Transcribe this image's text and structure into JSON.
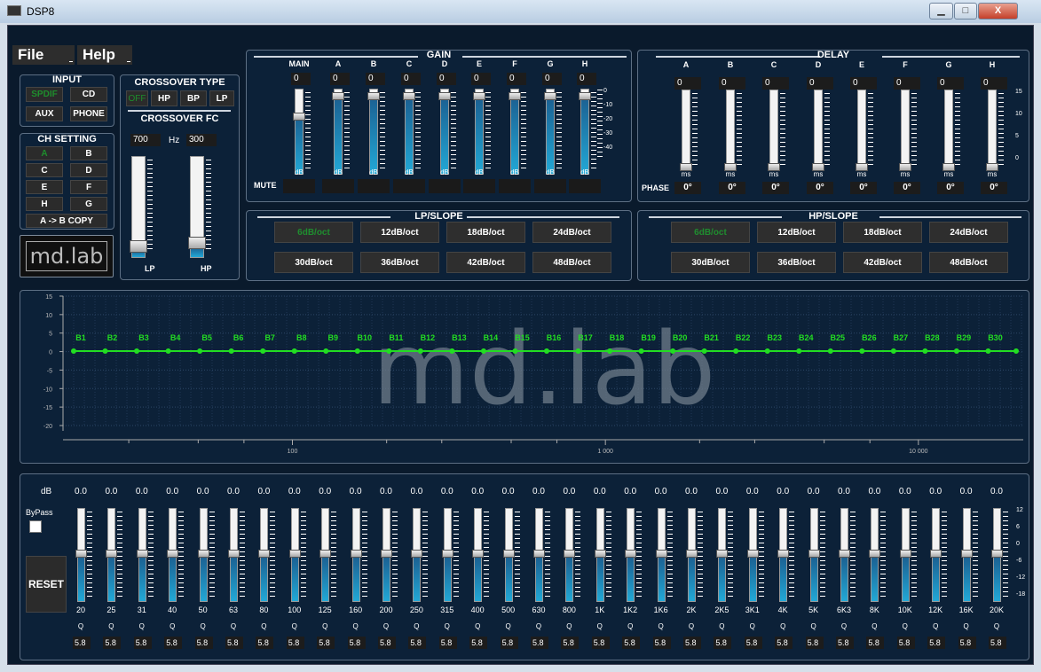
{
  "window": {
    "title": "DSP8",
    "minimize": "▁",
    "maximize": "□",
    "close": "X"
  },
  "menu": {
    "file": "File",
    "help": "Help"
  },
  "input": {
    "title": "INPUT",
    "buttons": [
      {
        "label": "SPDIF",
        "selected": true
      },
      {
        "label": "CD",
        "selected": false
      },
      {
        "label": "AUX",
        "selected": false
      },
      {
        "label": "PHONE",
        "selected": false
      }
    ]
  },
  "ch_setting": {
    "title": "CH SETTING",
    "buttons": [
      {
        "label": "A",
        "selected": true
      },
      {
        "label": "B"
      },
      {
        "label": "C"
      },
      {
        "label": "D"
      },
      {
        "label": "E"
      },
      {
        "label": "F"
      },
      {
        "label": "H"
      },
      {
        "label": "G"
      }
    ],
    "copy": "A -> B COPY"
  },
  "logo": {
    "text": "md.lab"
  },
  "crossover_type": {
    "title": "CROSSOVER TYPE",
    "buttons": [
      {
        "label": "OFF",
        "selected": true
      },
      {
        "label": "HP"
      },
      {
        "label": "BP"
      },
      {
        "label": "LP"
      }
    ]
  },
  "crossover_fc": {
    "title": "CROSSOVER FC",
    "lp_value": "700",
    "hz": "Hz",
    "hp_value": "300",
    "lp_label": "LP",
    "hp_label": "HP",
    "lp_level": 0.06,
    "hp_level": 0.1
  },
  "gain": {
    "title": "GAIN",
    "channels": [
      {
        "name": "MAIN",
        "value": "0",
        "level": 0.7
      },
      {
        "name": "A",
        "value": "0",
        "level": 0.95
      },
      {
        "name": "B",
        "value": "0",
        "level": 0.95
      },
      {
        "name": "C",
        "value": "0",
        "level": 0.95
      },
      {
        "name": "D",
        "value": "0",
        "level": 0.95
      },
      {
        "name": "E",
        "value": "0",
        "level": 0.95
      },
      {
        "name": "F",
        "value": "0",
        "level": 0.95
      },
      {
        "name": "G",
        "value": "0",
        "level": 0.95
      },
      {
        "name": "H",
        "value": "0",
        "level": 0.95
      }
    ],
    "unit": "dB",
    "mute": "MUTE",
    "scale": [
      "0",
      "-10",
      "-20",
      "-30",
      "-40"
    ]
  },
  "delay": {
    "title": "DELAY",
    "channels": [
      "A",
      "B",
      "C",
      "D",
      "E",
      "F",
      "G",
      "H"
    ],
    "values": [
      "0",
      "0",
      "0",
      "0",
      "0",
      "0",
      "0",
      "0"
    ],
    "unit": "ms",
    "phase_label": "PHASE",
    "phases": [
      "0°",
      "0°",
      "0°",
      "0°",
      "0°",
      "0°",
      "0°",
      "0°"
    ],
    "scale": [
      "15",
      "10",
      "5",
      "0"
    ]
  },
  "lp_slope": {
    "title": "LP/SLOPE",
    "options": [
      "6dB/oct",
      "12dB/oct",
      "18dB/oct",
      "24dB/oct",
      "30dB/oct",
      "36dB/oct",
      "42dB/oct",
      "48dB/oct"
    ],
    "selected": "6dB/oct"
  },
  "hp_slope": {
    "title": "HP/SLOPE",
    "options": [
      "6dB/oct",
      "12dB/oct",
      "18dB/oct",
      "24dB/oct",
      "30dB/oct",
      "36dB/oct",
      "42dB/oct",
      "48dB/oct"
    ],
    "selected": "6dB/oct"
  },
  "graph": {
    "watermark": "md.lab",
    "y_ticks": [
      "15",
      "10",
      "5",
      "0",
      "-5",
      "-10",
      "-15",
      "-20"
    ],
    "x_ticks": [
      "100",
      "1 000",
      "10 000"
    ],
    "bands": [
      "B1",
      "B2",
      "B3",
      "B4",
      "B5",
      "B6",
      "B7",
      "B8",
      "B9",
      "B10",
      "B11",
      "B12",
      "B13",
      "B14",
      "B15",
      "B16",
      "B17",
      "B18",
      "B19",
      "B20",
      "B21",
      "B22",
      "B23",
      "B24",
      "B25",
      "B26",
      "B27",
      "B28",
      "B29",
      "B30"
    ],
    "line_color": "#22dd22"
  },
  "eq": {
    "db_label": "dB",
    "bypass": "ByPass",
    "reset": "RESET",
    "q_label": "Q",
    "freqs": [
      "20",
      "25",
      "31",
      "40",
      "50",
      "63",
      "80",
      "100",
      "125",
      "160",
      "200",
      "250",
      "315",
      "400",
      "500",
      "630",
      "800",
      "1K",
      "1K2",
      "1K6",
      "2K",
      "2K5",
      "3K1",
      "4K",
      "5K",
      "6K3",
      "8K",
      "10K",
      "12K",
      "16K",
      "20K"
    ],
    "gain": "0.0",
    "q": "5.8",
    "scale": [
      "12",
      "6",
      "0",
      "-6",
      "-12",
      "-18"
    ]
  }
}
